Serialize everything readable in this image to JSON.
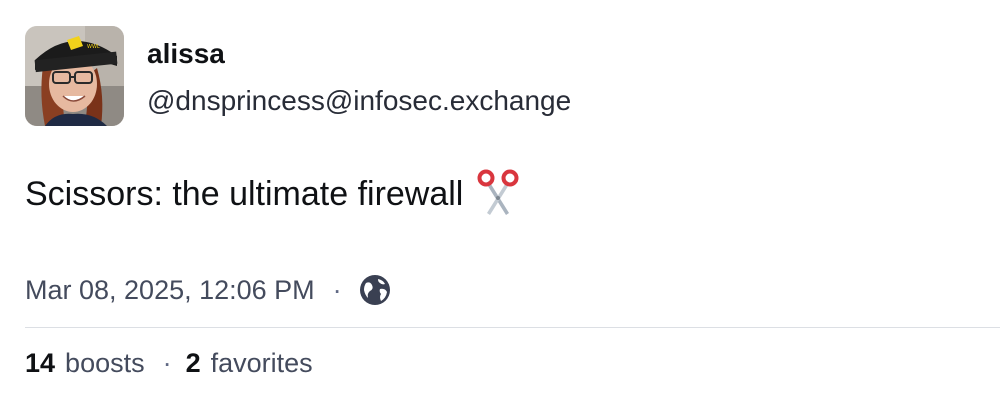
{
  "author": {
    "display_name": "alissa",
    "handle": "@dnsprincess@infosec.exchange",
    "avatar_icon": "profile-photo"
  },
  "post": {
    "text": "Scissors: the ultimate firewall",
    "emoji_icon": "scissors-icon"
  },
  "meta": {
    "timestamp": "Mar 08, 2025, 12:06 PM",
    "separator": "·",
    "visibility_icon": "globe-icon"
  },
  "stats": {
    "boosts_count": "14",
    "boosts_label": "boosts",
    "separator": "·",
    "favorites_count": "2",
    "favorites_label": "favorites"
  },
  "colors": {
    "text_primary": "#0f1114",
    "text_secondary": "#444b5d",
    "divider": "#dcdfe4",
    "scissors_handle": "#d9363e",
    "scissors_blade": "#aab4bf"
  }
}
